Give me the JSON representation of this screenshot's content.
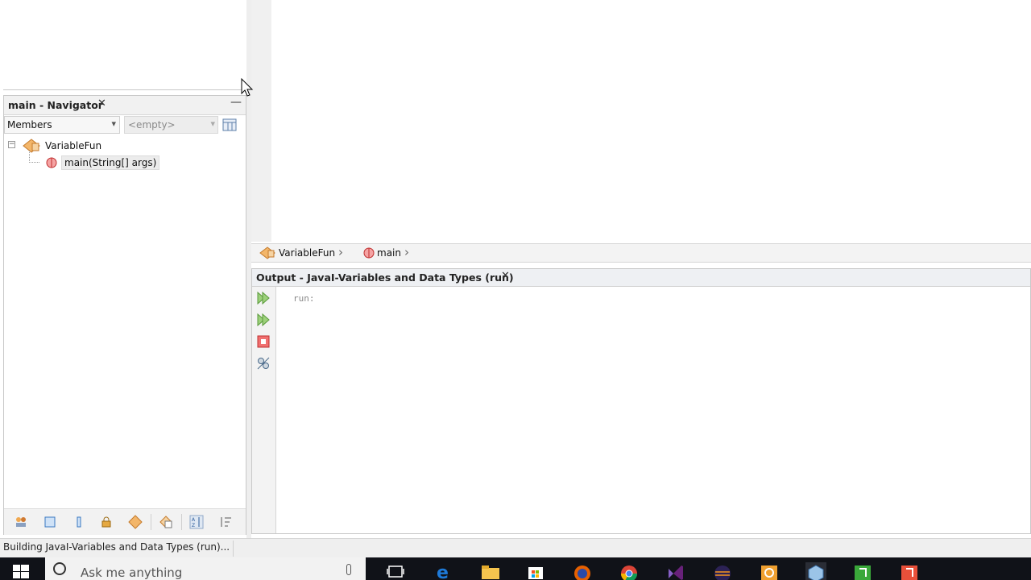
{
  "navigator": {
    "title": "main - Navigator",
    "close_glyph": "✕",
    "minimize_glyph": "—",
    "filter_select": {
      "selected": "Members",
      "icon": "chevron-down-icon"
    },
    "second_select": {
      "selected": "<empty>",
      "icon": "chevron-down-icon"
    },
    "tree": {
      "root": {
        "label": "VariableFun",
        "icon": "java-class-icon",
        "expander": "−"
      },
      "children": [
        {
          "label": "main(String[] args)",
          "icon": "method-icon"
        }
      ]
    },
    "toolbar_icons": [
      "fields-icon",
      "square-icon",
      "inner-icon",
      "lock-icon",
      "class-icon",
      "open-icon",
      "sort-icon",
      "sort-order-icon"
    ]
  },
  "breadcrumb": {
    "items": [
      {
        "label": "VariableFun",
        "icon": "java-class-icon"
      },
      {
        "label": "main",
        "icon": "method-icon"
      }
    ],
    "separator": "›"
  },
  "output": {
    "title": "Output - JavaI-Variables and Data Types (run)",
    "close_glyph": "✕",
    "text": "run:",
    "side_icons": [
      "rerun-icon",
      "rerun-with-options-icon",
      "stop-icon",
      "settings-icon"
    ]
  },
  "status": {
    "text": "Building JavaI-Variables and Data Types (run)..."
  },
  "taskbar": {
    "search_placeholder": "Ask me anything",
    "apps": [
      "task-view-icon",
      "edge-icon",
      "file-explorer-icon",
      "store-icon",
      "firefox-icon",
      "chrome-icon",
      "visual-studio-icon",
      "eclipse-icon",
      "settings-app-icon",
      "netbeans-icon",
      "app-green-icon",
      "app-red-icon"
    ]
  },
  "colors": {
    "taskbar_bg": "#101218",
    "rerun_green": "#7bbf5a",
    "stop_red": "#e04040"
  }
}
